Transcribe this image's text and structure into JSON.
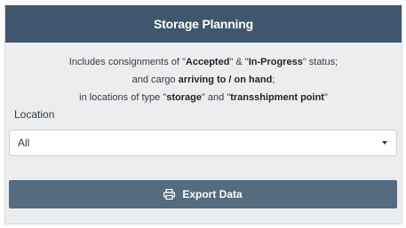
{
  "panel": {
    "title": "Storage Planning"
  },
  "description": {
    "line1": {
      "prefix": "Includes consignments of \"",
      "accepted": "Accepted",
      "mid": "\" & \"",
      "in_progress": "In-Progress",
      "suffix": "\" status;"
    },
    "line2": {
      "prefix": "and cargo ",
      "arriving": "arriving to / on hand",
      "suffix": ";"
    },
    "line3": {
      "prefix": "in locations of type \"",
      "storage": "storage",
      "mid": "\" and \"",
      "transshipment": "transshipment point",
      "suffix": "\""
    }
  },
  "location": {
    "label": "Location",
    "selected": "All"
  },
  "export_button": {
    "label": "Export Data",
    "icon": "printer-icon"
  },
  "colors": {
    "header": "#3f566c",
    "button": "#546b80",
    "panel_bg": "#ecedef"
  }
}
